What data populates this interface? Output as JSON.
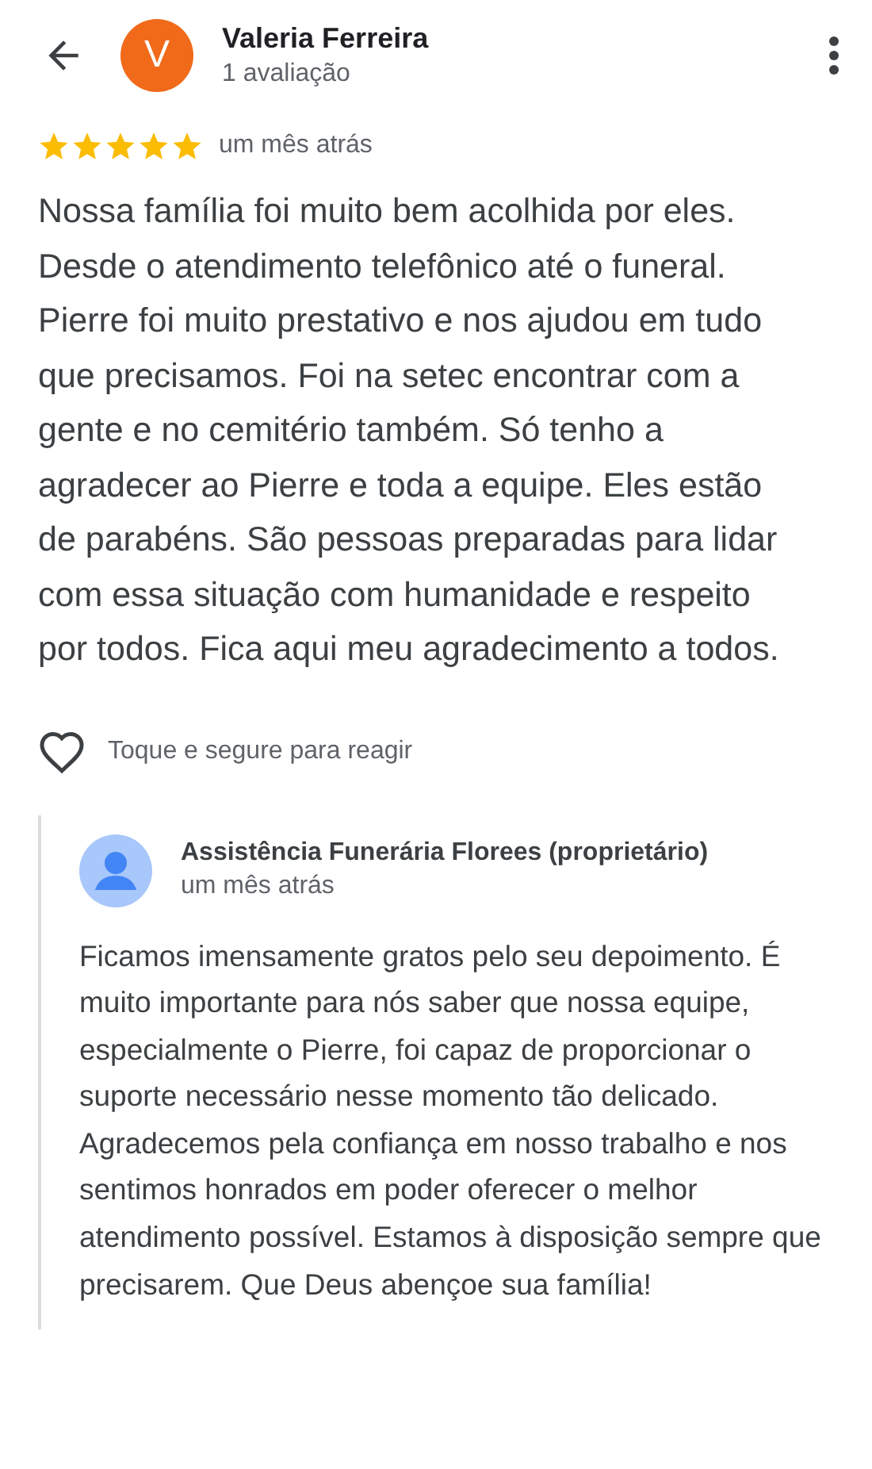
{
  "reviewer": {
    "initial": "V",
    "name": "Valeria Ferreira",
    "review_count": "1 avaliação"
  },
  "review": {
    "stars": 5,
    "time": "um mês atrás",
    "text": "Nossa família foi muito bem acolhida por eles. Desde o atendimento telefônico até o funeral. Pierre foi muito prestativo e nos ajudou em tudo que precisamos. Foi na setec encontrar com a gente e no cemitério também. Só tenho a agradecer ao Pierre e toda a equipe. Eles estão de parabéns. São pessoas preparadas para lidar com essa situação com humanidade e respeito por todos. Fica aqui meu agradecimento a todos."
  },
  "reaction": {
    "liked": false,
    "hint": "Toque e segure para reagir"
  },
  "owner_reply": {
    "name": "Assistência Funerária Florees (proprietário)",
    "time": "um mês atrás",
    "text": "Ficamos imensamente gratos pelo seu depoimento. É muito importante para nós saber que nossa equipe, especialmente o Pierre, foi capaz de proporcionar o suporte necessário nesse momento tão delicado. Agradecemos pela confiança em nosso trabalho e nos sentimos honrados em poder oferecer o melhor atendimento possível. Estamos à disposição sempre que precisarem. Que Deus abençoe sua família!"
  }
}
